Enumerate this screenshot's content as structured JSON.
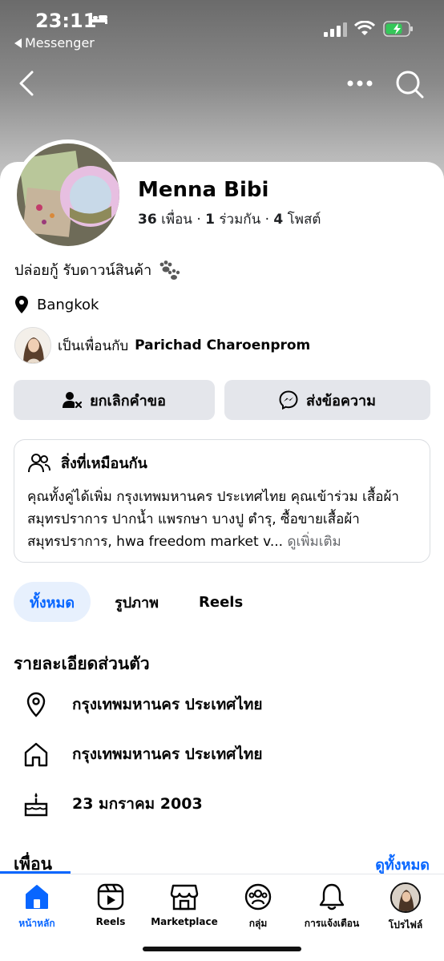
{
  "status_bar": {
    "time": "23:11",
    "back_app": "Messenger"
  },
  "profile": {
    "name": "Menna Bibi",
    "stats": {
      "friends_count": "36",
      "friends_label": "เพื่อน",
      "mutual_count": "1",
      "mutual_label": "ร่วมกัน",
      "posts_count": "4",
      "posts_label": "โพสต์",
      "separator": "·"
    },
    "bio": "ปล่อยกู้  รับดาวน์สินค้า",
    "location": "Bangkok",
    "friend_of_prefix": "เป็นเพื่อนกับ",
    "friend_of_name": "Parichad Charoenprom"
  },
  "actions": {
    "cancel_request": "ยกเลิกคำขอ",
    "send_message": "ส่งข้อความ"
  },
  "mutual_box": {
    "title": "สิ่งที่เหมือนกัน",
    "text": "คุณทั้งคู่ได้เพิ่ม กรุงเทพมหานคร ประเทศไทย คุณเข้าร่วม เสื้อผ้า สมุทรปราการ ปากน้ำ แพรกษา บางปู ตำรุ, ซื้อขายเสื้อผ้าสมุทรปราการ, hwa freedom market v...",
    "see_more": "ดูเพิ่มเติม"
  },
  "tabs": [
    {
      "label": "ทั้งหมด",
      "active": true
    },
    {
      "label": "รูปภาพ",
      "active": false
    },
    {
      "label": "Reels",
      "active": false
    }
  ],
  "details": {
    "title": "รายละเอียดส่วนตัว",
    "current_city": "กรุงเทพมหานคร ประเทศไทย",
    "hometown": "กรุงเทพมหานคร ประเทศไทย",
    "birthday": "23 มกราคม  2003"
  },
  "friends": {
    "title": "เพื่อน",
    "see_all": "ดูทั้งหมด"
  },
  "bottom_nav": [
    {
      "label": "หน้าหลัก",
      "icon": "home-icon",
      "active": true
    },
    {
      "label": "Reels",
      "icon": "reels-icon",
      "active": false
    },
    {
      "label": "Marketplace",
      "icon": "marketplace-icon",
      "active": false
    },
    {
      "label": "กลุ่ม",
      "icon": "groups-icon",
      "active": false
    },
    {
      "label": "การแจ้งเตือน",
      "icon": "bell-icon",
      "active": false
    },
    {
      "label": "โปรไฟล์",
      "icon": "profile-avatar",
      "active": false
    }
  ],
  "colors": {
    "accent": "#0866ff",
    "button_bg": "#e4e6eb",
    "active_tab_bg": "#e7f0fd"
  }
}
